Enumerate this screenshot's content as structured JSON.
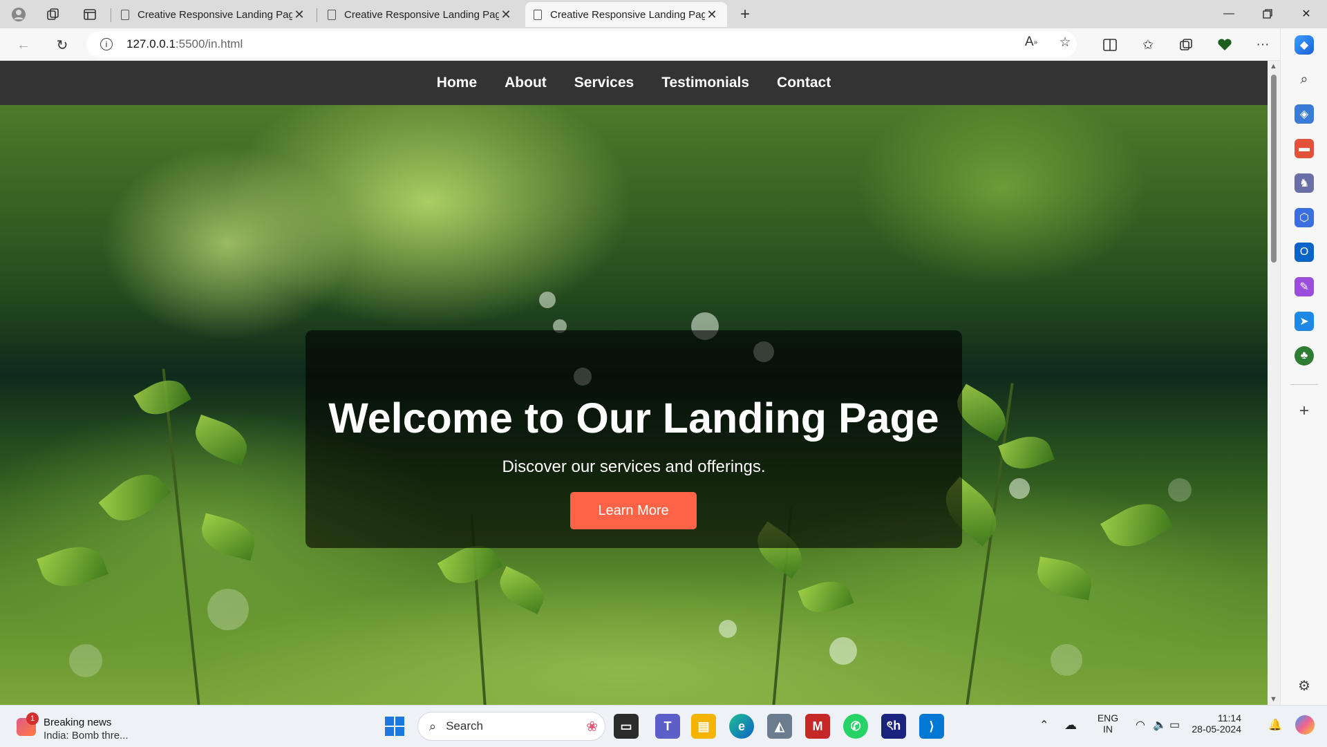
{
  "browser": {
    "tabs": [
      {
        "title": "Creative Responsive Landing Pag",
        "active": false
      },
      {
        "title": "Creative Responsive Landing Pag",
        "active": false
      },
      {
        "title": "Creative Responsive Landing Pag",
        "active": true
      }
    ],
    "url_host": "127.0.0.1",
    "url_path": ":5500/in.html"
  },
  "page": {
    "nav": [
      "Home",
      "About",
      "Services",
      "Testimonials",
      "Contact"
    ],
    "hero_title": "Welcome to Our Landing Page",
    "hero_subtitle": "Discover our services and offerings.",
    "hero_button": "Learn More"
  },
  "taskbar": {
    "news_title": "Breaking news",
    "news_text": "India: Bomb thre...",
    "news_badge": "1",
    "search_label": "Search",
    "lang_line1": "ENG",
    "lang_line2": "IN",
    "time": "11:14",
    "date": "28-05-2024"
  },
  "colors": {
    "navbar_bg": "#333333",
    "button_bg": "#ff6347",
    "overlay": "rgba(0,0,0,0.6)"
  }
}
